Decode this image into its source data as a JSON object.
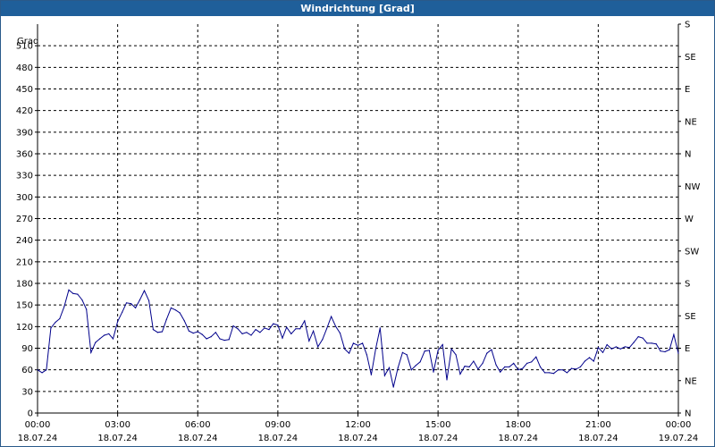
{
  "window": {
    "title": "Windrichtung [Grad]"
  },
  "chart_data": {
    "type": "line",
    "title": "Windrichtung [Grad]",
    "ylabel": "Grad",
    "xlabel": "",
    "ylim": [
      0,
      540
    ],
    "yticks": [
      0,
      30,
      60,
      90,
      120,
      150,
      180,
      210,
      240,
      270,
      300,
      330,
      360,
      390,
      420,
      450,
      480,
      510
    ],
    "y2ticks": [
      {
        "value": 0,
        "label": "N"
      },
      {
        "value": 45,
        "label": "NE"
      },
      {
        "value": 90,
        "label": "E"
      },
      {
        "value": 135,
        "label": "SE"
      },
      {
        "value": 180,
        "label": "S"
      },
      {
        "value": 225,
        "label": "SW"
      },
      {
        "value": 270,
        "label": "W"
      },
      {
        "value": 315,
        "label": "NW"
      },
      {
        "value": 360,
        "label": "N"
      },
      {
        "value": 405,
        "label": "NE"
      },
      {
        "value": 450,
        "label": "E"
      },
      {
        "value": 495,
        "label": "SE"
      },
      {
        "value": 540,
        "label": "S"
      }
    ],
    "xlim": [
      0,
      24
    ],
    "xticks": [
      {
        "value": 0,
        "time": "00:00",
        "date": "18.07.24"
      },
      {
        "value": 3,
        "time": "03:00",
        "date": "18.07.24"
      },
      {
        "value": 6,
        "time": "06:00",
        "date": "18.07.24"
      },
      {
        "value": 9,
        "time": "09:00",
        "date": "18.07.24"
      },
      {
        "value": 12,
        "time": "12:00",
        "date": "18.07.24"
      },
      {
        "value": 15,
        "time": "15:00",
        "date": "18.07.24"
      },
      {
        "value": 18,
        "time": "18:00",
        "date": "18.07.24"
      },
      {
        "value": 21,
        "time": "21:00",
        "date": "18.07.24"
      },
      {
        "value": 24,
        "time": "00:00",
        "date": "19.07.24"
      }
    ],
    "grid": true,
    "series": [
      {
        "color": "#00008b",
        "x": [
          0,
          0.17,
          0.33,
          0.5,
          0.67,
          0.83,
          1.0,
          1.17,
          1.33,
          1.5,
          1.67,
          1.83,
          2.0,
          2.17,
          2.33,
          2.5,
          2.67,
          2.83,
          3.0,
          3.17,
          3.33,
          3.5,
          3.67,
          3.83,
          4.0,
          4.17,
          4.33,
          4.5,
          4.67,
          4.83,
          5.0,
          5.17,
          5.33,
          5.5,
          5.67,
          5.83,
          6.0,
          6.17,
          6.33,
          6.5,
          6.67,
          6.83,
          7.0,
          7.17,
          7.33,
          7.5,
          7.67,
          7.83,
          8.0,
          8.17,
          8.33,
          8.5,
          8.67,
          8.83,
          9.0,
          9.17,
          9.33,
          9.5,
          9.67,
          9.83,
          10.0,
          10.17,
          10.33,
          10.5,
          10.67,
          10.83,
          11.0,
          11.17,
          11.33,
          11.5,
          11.67,
          11.83,
          12.0,
          12.17,
          12.33,
          12.5,
          12.67,
          12.83,
          13.0,
          13.17,
          13.33,
          13.5,
          13.67,
          13.83,
          14.0,
          14.17,
          14.33,
          14.5,
          14.67,
          14.83,
          15.0,
          15.17,
          15.33,
          15.5,
          15.67,
          15.83,
          16.0,
          16.17,
          16.33,
          16.5,
          16.67,
          16.83,
          17.0,
          17.17,
          17.33,
          17.5,
          17.67,
          17.83,
          18.0,
          18.17,
          18.33,
          18.5,
          18.67,
          18.83,
          19.0,
          19.17,
          19.33,
          19.5,
          19.67,
          19.83,
          20.0,
          20.17,
          20.33,
          20.5,
          20.67,
          20.83,
          21.0,
          21.17,
          21.33,
          21.5,
          21.67,
          21.83,
          22.0,
          22.17,
          22.33,
          22.5,
          22.67,
          22.83,
          23.0,
          23.17,
          23.33,
          23.5,
          23.67,
          23.83,
          24.0
        ],
        "values": [
          60,
          56,
          60,
          118,
          126,
          131,
          148,
          171,
          166,
          165,
          157,
          144,
          84,
          98,
          103,
          108,
          110,
          103,
          127,
          140,
          153,
          152,
          146,
          157,
          170,
          156,
          116,
          112,
          113,
          130,
          146,
          143,
          139,
          128,
          114,
          111,
          113,
          109,
          103,
          106,
          112,
          103,
          101,
          102,
          121,
          117,
          110,
          112,
          108,
          116,
          112,
          118,
          116,
          124,
          122,
          104,
          119,
          110,
          117,
          117,
          128,
          100,
          114,
          92,
          102,
          117,
          134,
          120,
          111,
          89,
          83,
          97,
          94,
          97,
          81,
          53,
          90,
          118,
          52,
          63,
          36,
          63,
          84,
          81,
          60,
          66,
          71,
          86,
          87,
          57,
          87,
          95,
          46,
          89,
          81,
          54,
          65,
          64,
          72,
          61,
          69,
          83,
          88,
          67,
          57,
          64,
          64,
          69,
          60,
          62,
          69,
          71,
          78,
          64,
          56,
          56,
          55,
          60,
          60,
          56,
          62,
          61,
          64,
          72,
          77,
          72,
          91,
          84,
          95,
          89,
          92,
          89,
          92,
          91,
          98,
          106,
          104,
          97,
          97,
          96,
          86,
          85,
          88,
          109,
          83
        ]
      }
    ]
  }
}
